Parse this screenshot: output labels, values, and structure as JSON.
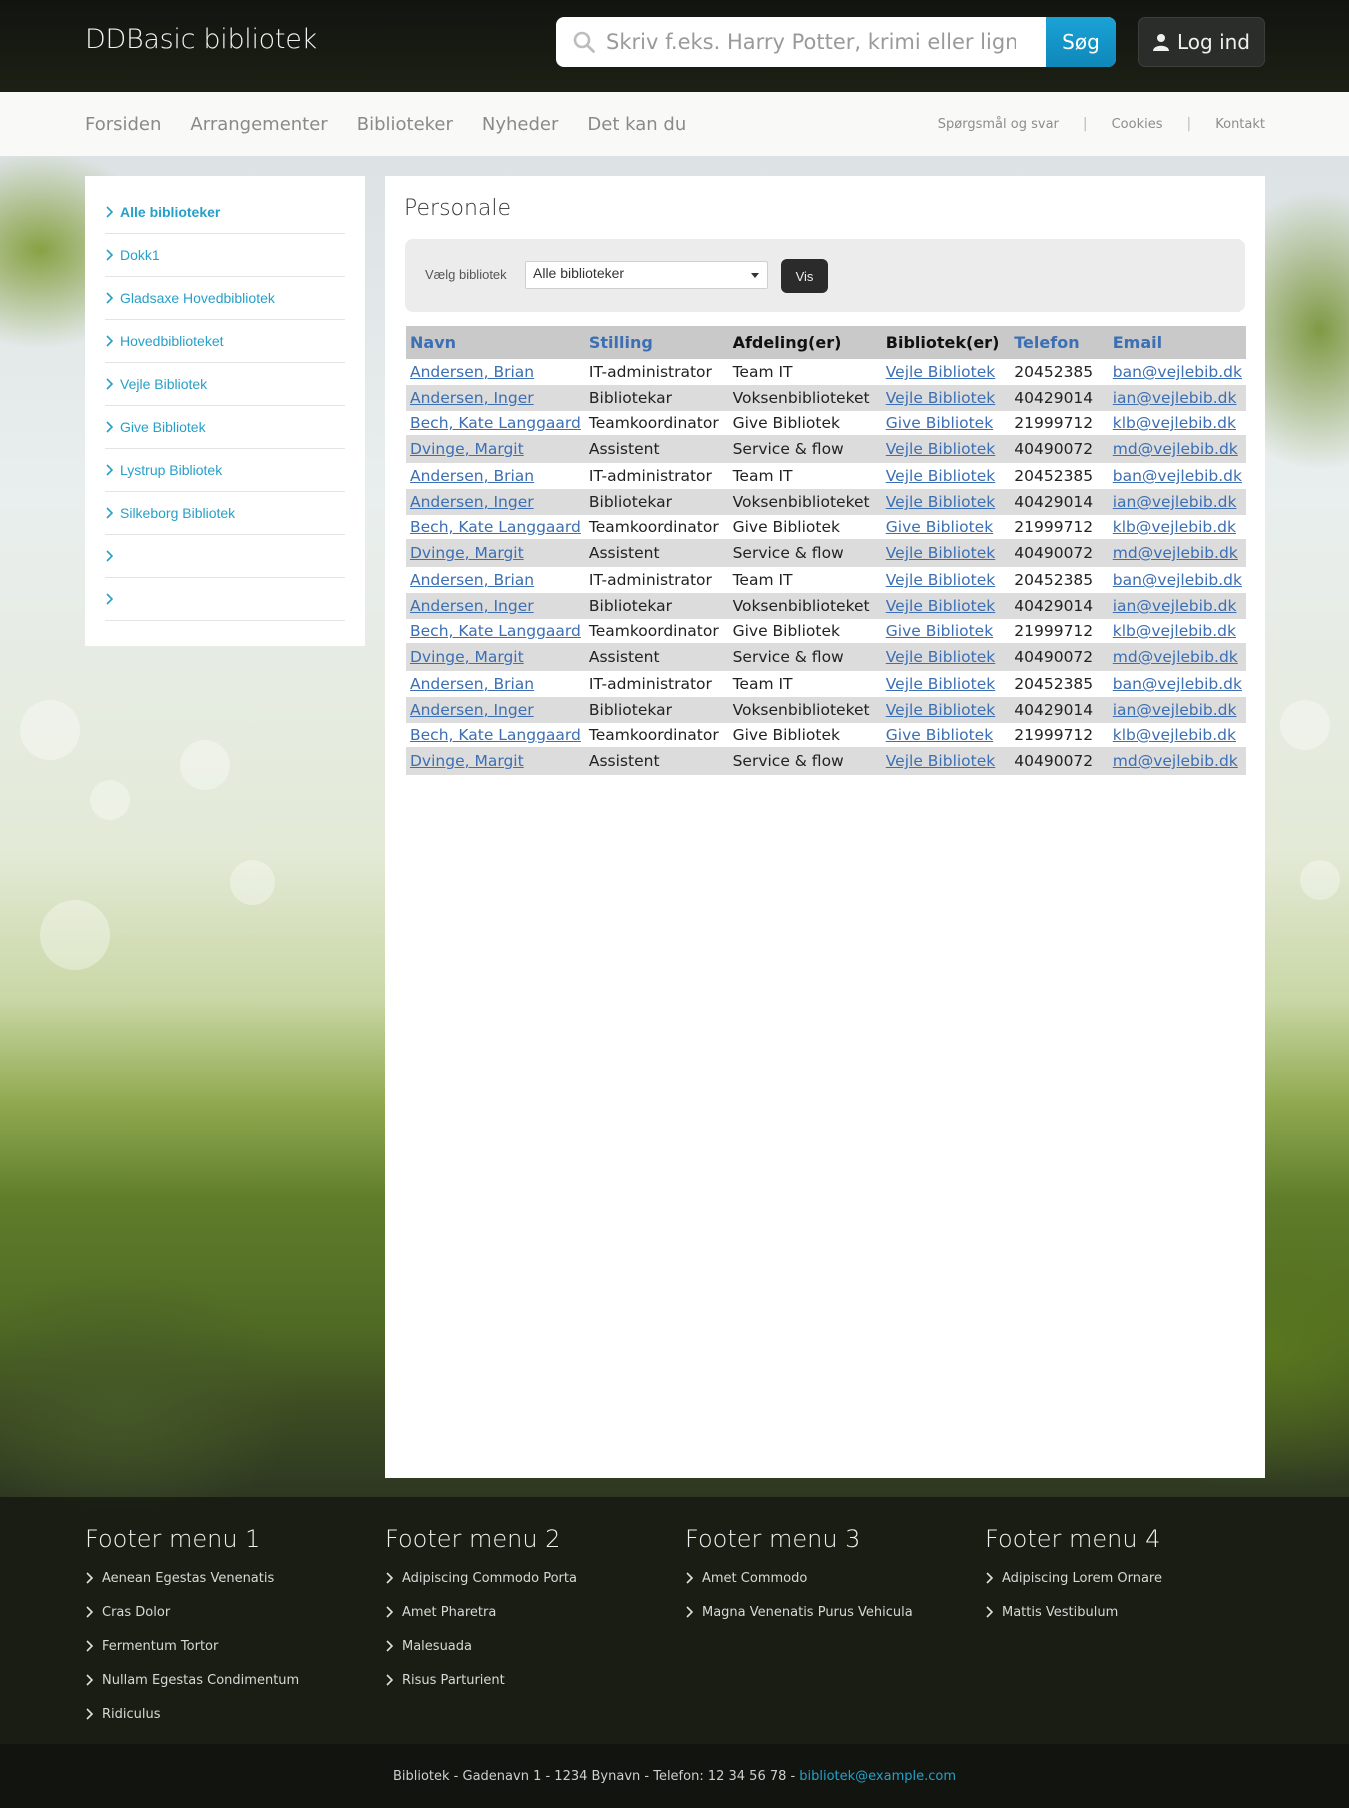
{
  "header": {
    "brand": "DDBasic bibliotek",
    "search_placeholder": "Skriv f.eks. Harry Potter, krimi eller lign.",
    "search_button": "Søg",
    "login_button": "Log ind"
  },
  "nav": {
    "main": [
      "Forsiden",
      "Arrangementer",
      "Biblioteker",
      "Nyheder",
      "Det kan du"
    ],
    "utility": [
      "Spørgsmål og svar",
      "Cookies",
      "Kontakt"
    ]
  },
  "sidebar": {
    "items": [
      "Alle biblioteker",
      "Dokk1",
      "Gladsaxe Hovedbibliotek",
      "Hovedbiblioteket",
      "Vejle Bibliotek",
      "Give Bibliotek",
      "Lystrup Bibliotek",
      "Silkeborg Bibliotek",
      "",
      ""
    ]
  },
  "main": {
    "title": "Personale",
    "filter": {
      "label": "Vælg bibliotek",
      "selected": "Alle biblioteker",
      "button": "Vis"
    },
    "table": {
      "headers": [
        "Navn",
        "Stilling",
        "Afdeling(er)",
        "Bibliotek(er)",
        "Telefon",
        "Email"
      ],
      "rows": [
        [
          "Andersen, Brian",
          "IT-administrator",
          "Team IT",
          "Vejle Bibliotek",
          "20452385",
          "ban@vejlebib.dk"
        ],
        [
          "Andersen, Inger",
          "Bibliotekar",
          "Voksenbiblioteket",
          "Vejle Bibliotek",
          "40429014",
          "ian@vejlebib.dk"
        ],
        [
          "Bech, Kate Langgaard",
          "Teamkoordinator",
          "Give Bibliotek",
          "Give Bibliotek",
          "21999712",
          "klb@vejlebib.dk"
        ],
        [
          "Dvinge, Margit",
          "Assistent",
          "Service & flow",
          "Vejle Bibliotek",
          "40490072",
          "md@vejlebib.dk"
        ],
        [
          "Andersen, Brian",
          "IT-administrator",
          "Team IT",
          "Vejle Bibliotek",
          "20452385",
          "ban@vejlebib.dk"
        ],
        [
          "Andersen, Inger",
          "Bibliotekar",
          "Voksenbiblioteket",
          "Vejle Bibliotek",
          "40429014",
          "ian@vejlebib.dk"
        ],
        [
          "Bech, Kate Langgaard",
          "Teamkoordinator",
          "Give Bibliotek",
          "Give Bibliotek",
          "21999712",
          "klb@vejlebib.dk"
        ],
        [
          "Dvinge, Margit",
          "Assistent",
          "Service & flow",
          "Vejle Bibliotek",
          "40490072",
          "md@vejlebib.dk"
        ],
        [
          "Andersen, Brian",
          "IT-administrator",
          "Team IT",
          "Vejle Bibliotek",
          "20452385",
          "ban@vejlebib.dk"
        ],
        [
          "Andersen, Inger",
          "Bibliotekar",
          "Voksenbiblioteket",
          "Vejle Bibliotek",
          "40429014",
          "ian@vejlebib.dk"
        ],
        [
          "Bech, Kate Langgaard",
          "Teamkoordinator",
          "Give Bibliotek",
          "Give Bibliotek",
          "21999712",
          "klb@vejlebib.dk"
        ],
        [
          "Dvinge, Margit",
          "Assistent",
          "Service & flow",
          "Vejle Bibliotek",
          "40490072",
          "md@vejlebib.dk"
        ],
        [
          "Andersen, Brian",
          "IT-administrator",
          "Team IT",
          "Vejle Bibliotek",
          "20452385",
          "ban@vejlebib.dk"
        ],
        [
          "Andersen, Inger",
          "Bibliotekar",
          "Voksenbiblioteket",
          "Vejle Bibliotek",
          "40429014",
          "ian@vejlebib.dk"
        ],
        [
          "Bech, Kate Langgaard",
          "Teamkoordinator",
          "Give Bibliotek",
          "Give Bibliotek",
          "21999712",
          "klb@vejlebib.dk"
        ],
        [
          "Dvinge, Margit",
          "Assistent",
          "Service & flow",
          "Vejle Bibliotek",
          "40490072",
          "md@vejlebib.dk"
        ]
      ]
    }
  },
  "footer": {
    "columns": [
      {
        "title": "Footer menu 1",
        "items": [
          "Aenean Egestas Venenatis",
          "Cras Dolor",
          "Fermentum Tortor",
          "Nullam Egestas Condimentum",
          "Ridiculus"
        ]
      },
      {
        "title": "Footer menu 2",
        "items": [
          "Adipiscing Commodo Porta",
          "Amet Pharetra",
          "Malesuada",
          "Risus Parturient"
        ]
      },
      {
        "title": "Footer menu 3",
        "items": [
          "Amet Commodo",
          "Magna Venenatis Purus Vehicula"
        ]
      },
      {
        "title": "Footer menu 4",
        "items": [
          "Adipiscing Lorem Ornare",
          "Mattis Vestibulum"
        ]
      }
    ],
    "address": "Bibliotek - Gadenavn 1 - 1234 Bynavn - Telefon: 12 34 56 78 - ",
    "email": "bibliotek@example.com"
  },
  "colors": {
    "accent": "#27a0c8",
    "link": "#3c6fb3",
    "search_button": "#1597c8"
  },
  "icons": {
    "search": "search-icon",
    "user": "user-icon",
    "chevron": "chevron-right-icon"
  }
}
